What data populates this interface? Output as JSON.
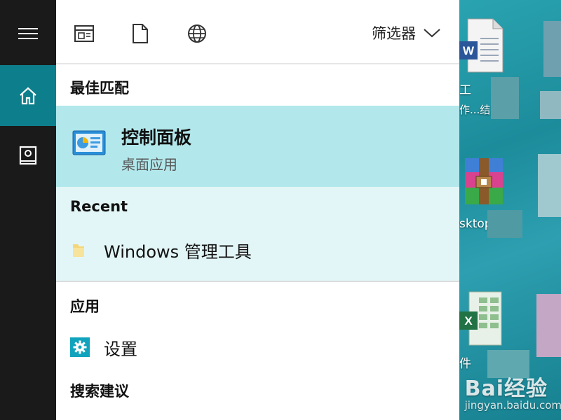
{
  "rail": {
    "menu_icon": "hamburger-icon",
    "home_icon": "home-icon",
    "notebook_icon": "notebook-icon"
  },
  "toolbar": {
    "icons": [
      "apps-icon",
      "documents-icon",
      "web-icon"
    ],
    "filter_label": "筛选器"
  },
  "best_match": {
    "header": "最佳匹配",
    "title": "控制面板",
    "subtitle": "桌面应用"
  },
  "recent": {
    "header": "Recent",
    "items": [
      {
        "label": "Windows 管理工具",
        "icon": "folder-icon"
      }
    ]
  },
  "apps": {
    "header": "应用",
    "items": [
      {
        "label": "设置",
        "icon": "gear-icon"
      }
    ]
  },
  "suggestions": {
    "header": "搜索建议"
  },
  "desktop": {
    "label1": "工",
    "label2": "作...结...",
    "label3": "sktop",
    "label4": "件"
  },
  "watermark": {
    "text": "Bai经验",
    "url": "jingyan.baidu.com"
  },
  "colors": {
    "rail": "#1a1a1a",
    "rail_active": "#0d7e8c",
    "best_match_bg": "#b2e8ec",
    "recent_bg": "#e3f6f7"
  }
}
